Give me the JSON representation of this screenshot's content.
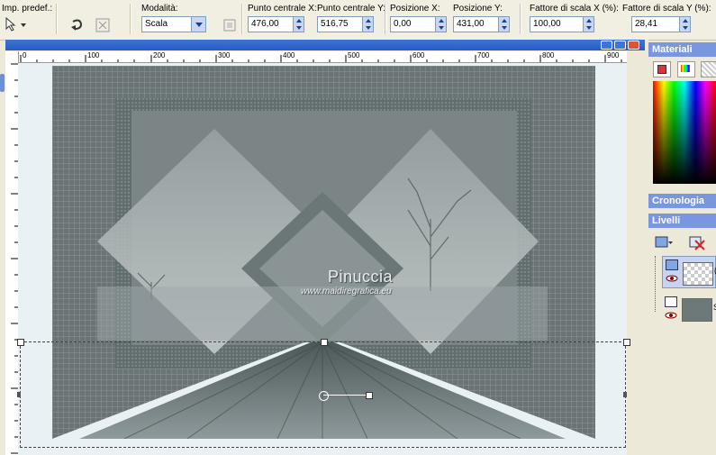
{
  "toolbar": {
    "preset_label": "Imp. predef.:",
    "mode_label": "Modalità:",
    "mode_value": "Scala",
    "center_x_label": "Punto centrale X:",
    "center_x_value": "476,00",
    "center_y_label": "Punto centrale Y:",
    "center_y_value": "516,75",
    "pos_x_label": "Posizione X:",
    "pos_x_value": "0,00",
    "pos_y_label": "Posizione Y:",
    "pos_y_value": "431,00",
    "scale_x_label": "Fattore di scala X (%):",
    "scale_x_value": "100,00",
    "scale_y_label": "Fattore di scala Y (%):",
    "scale_y_value": "28,41"
  },
  "ruler": {
    "ticks": [
      "0",
      "100",
      "200",
      "300",
      "400",
      "500",
      "600",
      "700",
      "800",
      "900"
    ]
  },
  "image": {
    "watermark_title": "Pinuccia",
    "watermark_url": "www.maidiregrafica.eu"
  },
  "panels": {
    "materials_title": "Materiali",
    "history_title": "Cronologia",
    "layers_title": "Livelli",
    "layer1_label": "(",
    "layer2_label": "S"
  },
  "colors": {
    "title_bar": "#3d74d6",
    "panel_header": "#7a96df"
  }
}
